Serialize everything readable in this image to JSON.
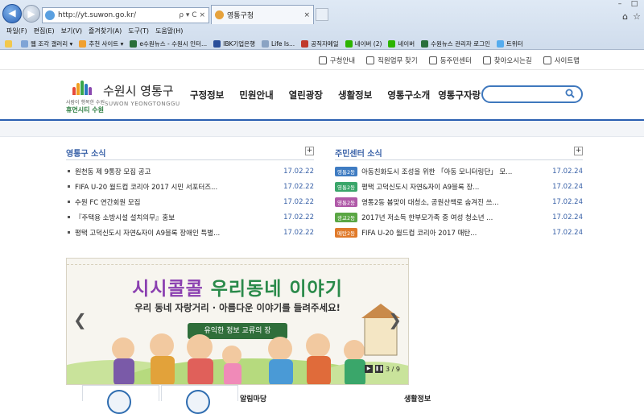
{
  "browser": {
    "url": "http://yt.suwon.go.kr/",
    "address_controls": "ρ ▾ C ×",
    "tab_title": "영통구청",
    "menu": [
      "파일(F)",
      "편집(E)",
      "보기(V)",
      "즐겨찾기(A)",
      "도구(T)",
      "도움말(H)"
    ],
    "favorites": [
      {
        "label": "웹 조각 갤러리 ▾",
        "color": "#7fa4d6"
      },
      {
        "label": "추천 사이트 ▾",
        "color": "#f0a030"
      },
      {
        "label": "e수원뉴스 - 수원시 인터...",
        "color": "#2a6f3a"
      },
      {
        "label": "IBK기업은행",
        "color": "#2a4f9a"
      },
      {
        "label": "Life Is...",
        "color": "#8aa3c3"
      },
      {
        "label": "공직자메일",
        "color": "#c0392b"
      },
      {
        "label": "네이버 (2)",
        "color": "#2db400"
      },
      {
        "label": "네이버",
        "color": "#2db400"
      },
      {
        "label": "수원뉴스 관리자 로그인",
        "color": "#2a6f3a"
      },
      {
        "label": "트위터",
        "color": "#55acee"
      }
    ]
  },
  "util": {
    "links": [
      "구청안내",
      "직원업무 찾기",
      "동주민센터",
      "찾아오시는길",
      "사이트맵"
    ]
  },
  "header": {
    "logo_tagline": "사람이 행복한 수원",
    "logo_brand": "휴먼시티 수원",
    "site_title": "수원시 영통구",
    "site_title_en": "SUWON YEONGTONGGU",
    "nav": [
      "구정정보",
      "민원안내",
      "열린광장",
      "생활정보",
      "영통구소개",
      "영통구자랑"
    ]
  },
  "news": {
    "title": "영통구 소식",
    "more": "+",
    "items": [
      {
        "text": "원천동 제 9통장 모집 공고",
        "date": "17.02.22"
      },
      {
        "text": "FIFA U-20 월드컵 코리아 2017 시민 서포터즈...",
        "date": "17.02.22"
      },
      {
        "text": "수원 FC 연간회원 모집",
        "date": "17.02.22"
      },
      {
        "text": "『주택용 소방시설 설치의무』홍보",
        "date": "17.02.22"
      },
      {
        "text": "평택 고덕신도시 자연&자이 A9블록 장애인 특별...",
        "date": "17.02.22"
      }
    ]
  },
  "center_news": {
    "title": "주민센터 소식",
    "more": "+",
    "items": [
      {
        "tag": "영통2동",
        "tag_color": "#3f7cc2",
        "text": "아동친화도시 조성을 위한 「아동 모니터링단」 모...",
        "date": "17.02.24"
      },
      {
        "tag": "영통2동",
        "tag_color": "#3aa66a",
        "text": "평택 고덕신도시 자연&자이 A9블록 장...",
        "date": "17.02.24"
      },
      {
        "tag": "영통2동",
        "tag_color": "#b05aa8",
        "text": "영통2동 봄맞이 대청소, 공원산책로 숨겨진 쓰...",
        "date": "17.02.24"
      },
      {
        "tag": "광교2동",
        "tag_color": "#5aa644",
        "text": "2017년 저소득 한부모가족 중 여성 청소년 ...",
        "date": "17.02.24"
      },
      {
        "tag": "매탄2동",
        "tag_color": "#e07a2a",
        "text": "FIFA U-20 월드컵 코리아 2017 매탄...",
        "date": "17.02.24"
      }
    ]
  },
  "banner": {
    "headline_part1": "시시콜콜",
    "headline_part2": "우리동네 이야기",
    "subtitle": "우리 동네 자랑거리 · 아름다운 이야기를 들려주세요!",
    "pill": "유익한 정보 교류의 장",
    "page": "3 / 9",
    "colors": {
      "part1": "#8a3fb0",
      "part2": "#2a8a4a"
    }
  },
  "bottom": {
    "labels": [
      "알림마당",
      "생활정보"
    ]
  },
  "icons": {
    "back": "back-arrow-icon",
    "forward": "forward-arrow-icon",
    "search": "search-icon",
    "home": "home-icon",
    "favorites": "star-icon"
  }
}
